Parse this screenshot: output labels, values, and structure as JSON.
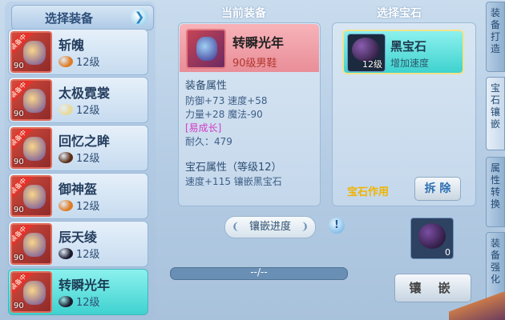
{
  "left_panel": {
    "title": "选择装备",
    "items": [
      {
        "name": "斩魄",
        "level": "12级",
        "tag": "装备中",
        "item_level": "90",
        "gem_color": "#e07a22"
      },
      {
        "name": "太极霓裳",
        "level": "12级",
        "tag": "装备中",
        "item_level": "90",
        "gem_color": "#e8d99a"
      },
      {
        "name": "回忆之眸",
        "level": "12级",
        "tag": "装备中",
        "item_level": "90",
        "gem_color": "#5a2c14"
      },
      {
        "name": "御神盔",
        "level": "12级",
        "tag": "装备中",
        "item_level": "90",
        "gem_color": "#e07a22"
      },
      {
        "name": "辰天绫",
        "level": "12级",
        "tag": "装备中",
        "item_level": "90",
        "gem_color": "#1a1a2e"
      },
      {
        "name": "转瞬光年",
        "level": "12级",
        "tag": "装备中",
        "item_level": "90",
        "gem_color": "#1a1a2e",
        "selected": true
      }
    ]
  },
  "current_equip": {
    "header": "当前装备",
    "name": "转瞬光年",
    "sub": "90级男鞋",
    "attr_title": "装备属性",
    "attr_line1": "防御+73 速度+58",
    "attr_line2": "力量+28 魔法-90",
    "attr_special": "[易成长]",
    "durability": "耐久：479",
    "gem_attr_title": "宝石属性（等级12）",
    "gem_attr_line": "速度+115 镶嵌黑宝石"
  },
  "gem_select": {
    "header": "选择宝石",
    "gem_name": "黑宝石",
    "gem_desc": "增加速度",
    "gem_level": "12级",
    "effect_label": "宝石作用",
    "remove_button": "拆 除"
  },
  "inlay": {
    "progress_label": "镶嵌进度",
    "progress_text": "--/--",
    "progress_fraction": 0,
    "info_icon": "!",
    "slot_count": "0",
    "inlay_button": "镶 嵌"
  },
  "side_tabs": [
    {
      "text": "装备打造"
    },
    {
      "text": "宝石镶嵌",
      "active": true
    },
    {
      "text": "属性转换"
    },
    {
      "text": "装备强化"
    }
  ],
  "colors": {
    "accent": "#3fd2cf",
    "gold": "#f0b400",
    "special": "#d33bc6"
  }
}
